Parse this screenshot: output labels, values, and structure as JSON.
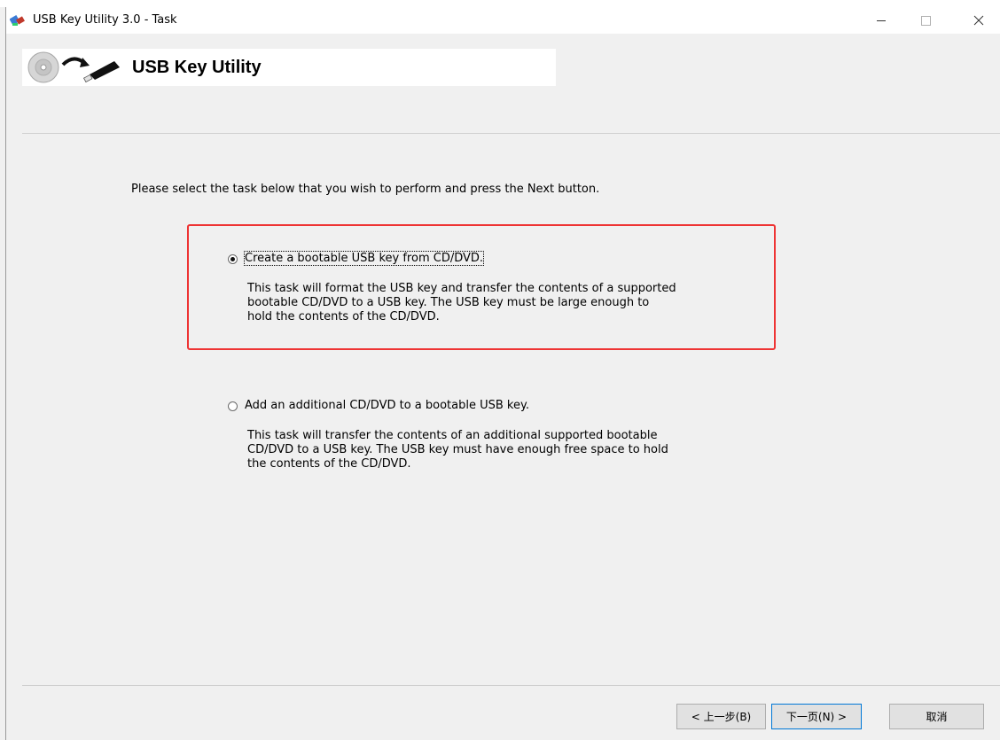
{
  "window": {
    "title": "USB Key Utility 3.0 - Task",
    "controls": {
      "minimize": "minimize",
      "maximize": "maximize",
      "close": "close"
    }
  },
  "banner": {
    "title": "USB Key Utility",
    "icon": "cd-to-usb-icon"
  },
  "instruction": "Please select the task below that you wish to perform and press the Next button.",
  "options": [
    {
      "label": "Create a bootable USB key from CD/DVD.",
      "description": "This task will format the USB key and transfer the contents of a supported\nbootable CD/DVD to a USB key.  The USB key must be large enough to\nhold the contents of the CD/DVD.",
      "selected": true
    },
    {
      "label": "Add an additional CD/DVD to a bootable USB key.",
      "description": "This task will transfer the contents of an additional supported bootable\nCD/DVD to a USB key.  The USB key must have enough free space to hold\nthe contents of the CD/DVD.",
      "selected": false
    }
  ],
  "buttons": {
    "back": "< 上一步(B)",
    "next": "下一页(N) >",
    "cancel": "取消"
  },
  "colors": {
    "highlight_border": "#ee3434",
    "default_button_border": "#0078d7",
    "dialog_background": "#f0f0f0"
  }
}
